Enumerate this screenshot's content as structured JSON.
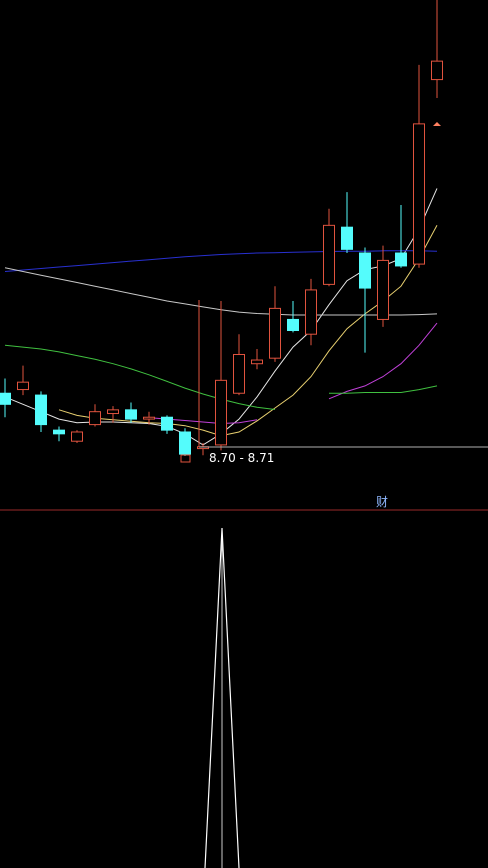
{
  "chart_data": [
    {
      "type": "candlestick",
      "annotations": {
        "low_marker_label": "8.70 - 8.71",
        "finance_badge": "财"
      },
      "colors": {
        "up": "#e0533e",
        "down": "#54fcfc",
        "ma_white": "#e6e6e6",
        "ma_yellow": "#e8d070",
        "ma_magenta": "#c040d8",
        "ma_green": "#40c040",
        "ma_blue": "#2830d0",
        "ma_gray": "#c8c8c8",
        "divider": "#9a2a2a",
        "marker_line": "#b0b0b0",
        "arrow": "#ff8060"
      },
      "candles": [
        {
          "o": 10.4,
          "h": 10.8,
          "l": 9.75,
          "c": 10.1
        },
        {
          "o": 10.5,
          "h": 11.15,
          "l": 10.35,
          "c": 10.7
        },
        {
          "o": 10.35,
          "h": 10.45,
          "l": 9.35,
          "c": 9.55
        },
        {
          "o": 9.4,
          "h": 9.5,
          "l": 9.1,
          "c": 9.3
        },
        {
          "o": 9.1,
          "h": 9.4,
          "l": 9.05,
          "c": 9.35
        },
        {
          "o": 9.55,
          "h": 10.1,
          "l": 9.5,
          "c": 9.9
        },
        {
          "o": 9.85,
          "h": 10.05,
          "l": 9.6,
          "c": 9.95
        },
        {
          "o": 9.95,
          "h": 10.15,
          "l": 9.6,
          "c": 9.7
        },
        {
          "o": 9.7,
          "h": 9.9,
          "l": 9.55,
          "c": 9.75
        },
        {
          "o": 9.75,
          "h": 9.8,
          "l": 9.3,
          "c": 9.4
        },
        {
          "o": 9.35,
          "h": 9.45,
          "l": 8.7,
          "c": 8.75
        },
        {
          "o": 8.9,
          "h": 9.05,
          "l": 8.72,
          "c": 8.95
        },
        {
          "o": 9.0,
          "h": 12.9,
          "l": 8.85,
          "c": 10.75
        },
        {
          "o": 10.4,
          "h": 12.0,
          "l": 10.35,
          "c": 11.45
        },
        {
          "o": 11.2,
          "h": 11.6,
          "l": 11.05,
          "c": 11.3
        },
        {
          "o": 11.35,
          "h": 13.3,
          "l": 11.25,
          "c": 12.7
        },
        {
          "o": 12.4,
          "h": 12.9,
          "l": 12.05,
          "c": 12.1
        },
        {
          "o": 12.0,
          "h": 13.5,
          "l": 11.7,
          "c": 13.2
        },
        {
          "o": 13.35,
          "h": 15.4,
          "l": 13.3,
          "c": 14.95
        },
        {
          "o": 14.9,
          "h": 15.85,
          "l": 14.2,
          "c": 14.3
        },
        {
          "o": 14.2,
          "h": 14.35,
          "l": 11.5,
          "c": 13.25
        },
        {
          "o": 12.4,
          "h": 14.4,
          "l": 12.2,
          "c": 14.0
        },
        {
          "o": 14.2,
          "h": 15.5,
          "l": 13.8,
          "c": 13.85
        },
        {
          "o": 13.9,
          "h": 19.3,
          "l": 13.8,
          "c": 17.7
        },
        {
          "o": 18.9,
          "h": 21.9,
          "l": 18.4,
          "c": 19.4
        }
      ],
      "ma_lines": [
        {
          "color_key": "ma_white",
          "values": [
            10.3,
            10.1,
            9.9,
            9.7,
            9.6,
            9.62,
            9.62,
            9.6,
            9.58,
            9.5,
            9.3,
            9.0,
            9.3,
            9.7,
            10.3,
            11.0,
            11.65,
            12.1,
            12.8,
            13.45,
            13.75,
            13.85,
            14.05,
            14.85,
            15.95
          ]
        },
        {
          "color_key": "ma_yellow",
          "values": [
            null,
            null,
            null,
            9.95,
            9.8,
            9.72,
            9.68,
            9.64,
            9.6,
            9.58,
            9.52,
            9.4,
            9.25,
            9.35,
            9.65,
            10.0,
            10.35,
            10.85,
            11.55,
            12.15,
            12.55,
            12.9,
            13.3,
            14.05,
            14.95
          ]
        },
        {
          "color_key": "ma_magenta",
          "values": [
            null,
            null,
            null,
            null,
            null,
            null,
            null,
            null,
            9.74,
            9.7,
            9.66,
            9.62,
            9.58,
            9.6,
            9.68,
            null,
            null,
            null,
            10.25,
            10.45,
            10.6,
            10.85,
            11.2,
            11.7,
            12.3
          ]
        },
        {
          "color_key": "ma_green",
          "values": [
            11.7,
            11.65,
            11.6,
            11.52,
            11.42,
            11.32,
            11.2,
            11.06,
            10.9,
            10.72,
            10.54,
            10.38,
            10.24,
            10.12,
            10.02,
            9.96,
            null,
            null,
            10.4,
            10.4,
            10.42,
            10.42,
            10.42,
            10.5,
            10.6
          ]
        },
        {
          "color_key": "ma_blue",
          "values": [
            13.7,
            13.74,
            13.78,
            13.82,
            13.86,
            13.9,
            13.94,
            13.98,
            14.02,
            14.06,
            14.1,
            14.13,
            14.16,
            14.18,
            14.2,
            14.21,
            14.22,
            14.23,
            14.24,
            14.25,
            14.25,
            14.26,
            14.26,
            14.26,
            14.25
          ]
        },
        {
          "color_key": "ma_gray",
          "values": [
            13.8,
            13.7,
            13.6,
            13.5,
            13.4,
            13.3,
            13.2,
            13.1,
            13.0,
            12.9,
            12.82,
            12.74,
            12.66,
            12.6,
            12.56,
            12.54,
            12.52,
            12.52,
            12.52,
            12.52,
            12.52,
            12.52,
            12.52,
            12.53,
            12.55
          ]
        }
      ]
    },
    {
      "type": "line",
      "x_peak_index": 12,
      "series": [
        {
          "values": [
            0,
            0,
            0,
            0,
            0,
            0,
            0,
            0,
            0,
            0,
            0,
            1,
            0
          ]
        }
      ]
    }
  ]
}
